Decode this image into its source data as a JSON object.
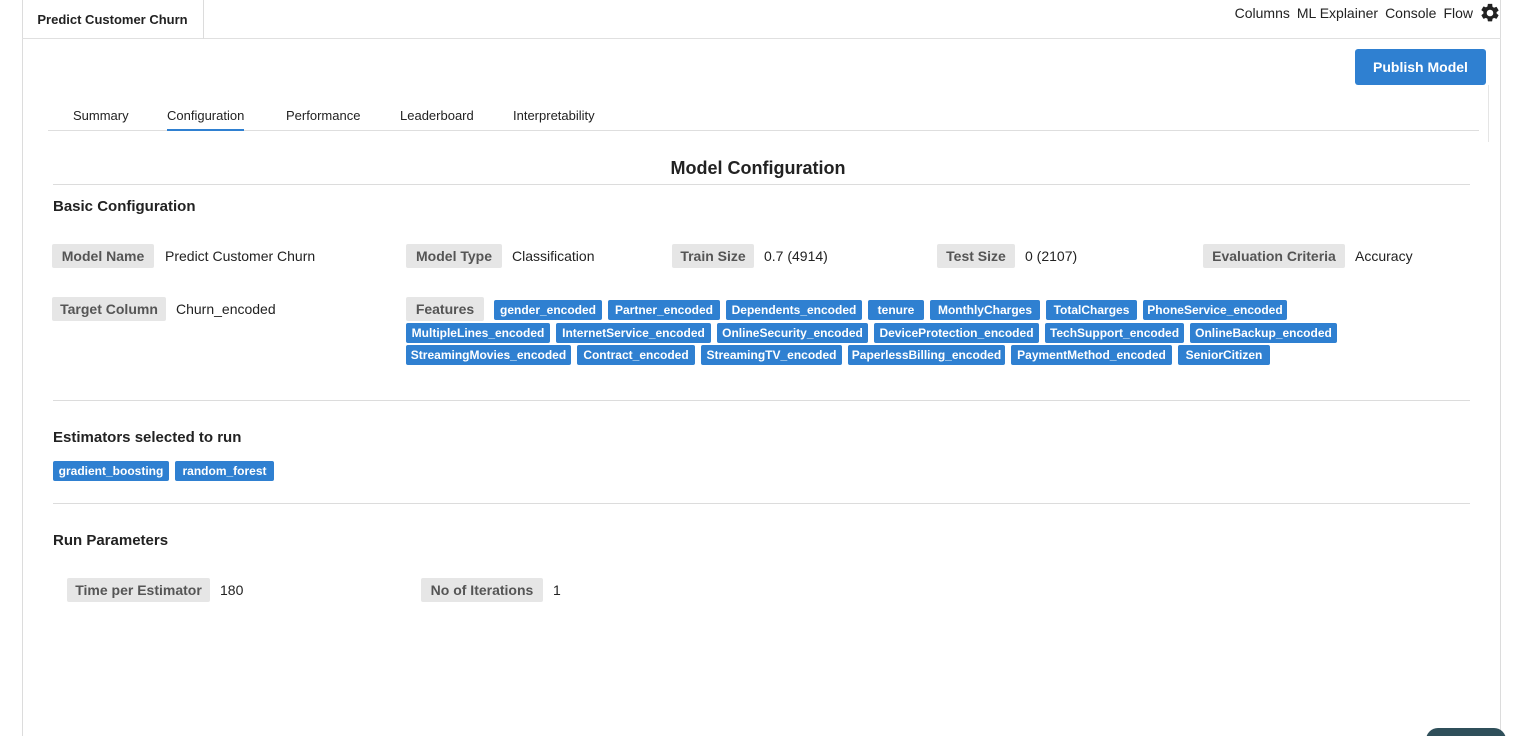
{
  "app": {
    "tab_title": "Predict Customer Churn"
  },
  "top_nav": {
    "items": [
      "Columns",
      "ML Explainer",
      "Console",
      "Flow"
    ],
    "settings_icon": "gear-icon"
  },
  "toolbar": {
    "publish_label": "Publish Model"
  },
  "tabs": [
    "Summary",
    "Configuration",
    "Performance",
    "Leaderboard",
    "Interpretability"
  ],
  "active_tab": "Configuration",
  "page_title": "Model Configuration",
  "basic": {
    "heading": "Basic Configuration",
    "model_name_label": "Model Name",
    "model_name": "Predict Customer Churn",
    "model_type_label": "Model Type",
    "model_type": "Classification",
    "train_size_label": "Train Size",
    "train_size": "0.7 (4914)",
    "test_size_label": "Test Size",
    "test_size": "0 (2107)",
    "evaluation_label": "Evaluation Criteria",
    "evaluation": "Accuracy",
    "target_label": "Target Column",
    "target": "Churn_encoded",
    "features_label": "Features",
    "features": [
      "gender_encoded",
      "Partner_encoded",
      "Dependents_encoded",
      "tenure",
      "MonthlyCharges",
      "TotalCharges",
      "PhoneService_encoded",
      "MultipleLines_encoded",
      "InternetService_encoded",
      "OnlineSecurity_encoded",
      "DeviceProtection_encoded",
      "TechSupport_encoded",
      "OnlineBackup_encoded",
      "StreamingMovies_encoded",
      "Contract_encoded",
      "StreamingTV_encoded",
      "PaperlessBilling_encoded",
      "PaymentMethod_encoded",
      "SeniorCitizen"
    ]
  },
  "estimators": {
    "heading": "Estimators selected to run",
    "items": [
      "gradient_boosting",
      "random_forest"
    ]
  },
  "run_params": {
    "heading": "Run Parameters",
    "time_label": "Time per Estimator",
    "time_value": "180",
    "iterations_label": "No of Iterations",
    "iterations_value": "1"
  },
  "colors": {
    "accent": "#2f80d1",
    "chip_bg": "#e6e6e6"
  }
}
